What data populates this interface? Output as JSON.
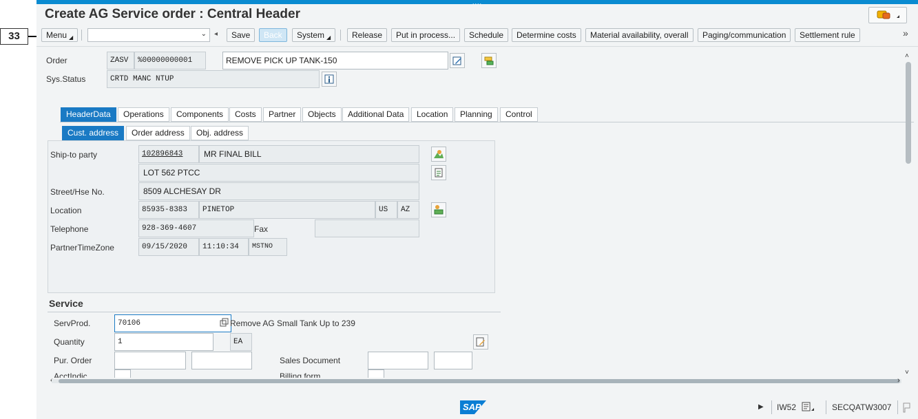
{
  "callout": {
    "number": "33"
  },
  "window": {
    "title": "Create AG Service order : Central Header"
  },
  "toolbar": {
    "menu": "Menu",
    "save": "Save",
    "back": "Back",
    "system": "System",
    "release": "Release",
    "put_in_process": "Put in process...",
    "schedule": "Schedule",
    "determine_costs": "Determine costs",
    "material_availability": "Material availability, overall",
    "paging": "Paging/communication",
    "settlement": "Settlement rule",
    "more": "»"
  },
  "header": {
    "order_label": "Order",
    "order_type": "ZASV",
    "order_number": "%00000000001",
    "description": "REMOVE PICK UP TANK-150",
    "status_label": "Sys.Status",
    "status_value": "CRTD MANC NTUP"
  },
  "tabs": [
    "HeaderData",
    "Operations",
    "Components",
    "Costs",
    "Partner",
    "Objects",
    "Additional Data",
    "Location",
    "Planning",
    "Control"
  ],
  "subtabs": [
    "Cust. address",
    "Order address",
    "Obj. address"
  ],
  "address": {
    "ship_to_label": "Ship-to party",
    "ship_to_id": "102896843",
    "ship_to_name": "MR FINAL BILL",
    "name2": "LOT 562 PTCC",
    "street_label": "Street/Hse No.",
    "street": "8509 ALCHESAY DR",
    "location_label": "Location",
    "postal": "85935-8383",
    "city": "PINETOP",
    "country": "US",
    "region": "AZ",
    "telephone_label": "Telephone",
    "telephone": "928-369-4607",
    "fax_label": "Fax",
    "fax": "",
    "timezone_label": "PartnerTimeZone",
    "date": "09/15/2020",
    "time": "11:10:34",
    "timezone": "MSTNO"
  },
  "service": {
    "section_title": "Service",
    "servprod_label": "ServProd.",
    "servprod": "70106",
    "servprod_desc": "Remove AG Small Tank Up to 239",
    "quantity_label": "Quantity",
    "quantity": "1",
    "unit": "EA",
    "pur_order_label": "Pur. Order",
    "sales_doc_label": "Sales Document",
    "acct_label": "AcctIndic.",
    "billing_label": "Billing form"
  },
  "status_bar": {
    "logo": "SAP",
    "transaction": "IW52",
    "system": "SECQATW3007"
  },
  "colors": {
    "accent": "#0a8bd1",
    "active_tab": "#1a7ac4"
  }
}
